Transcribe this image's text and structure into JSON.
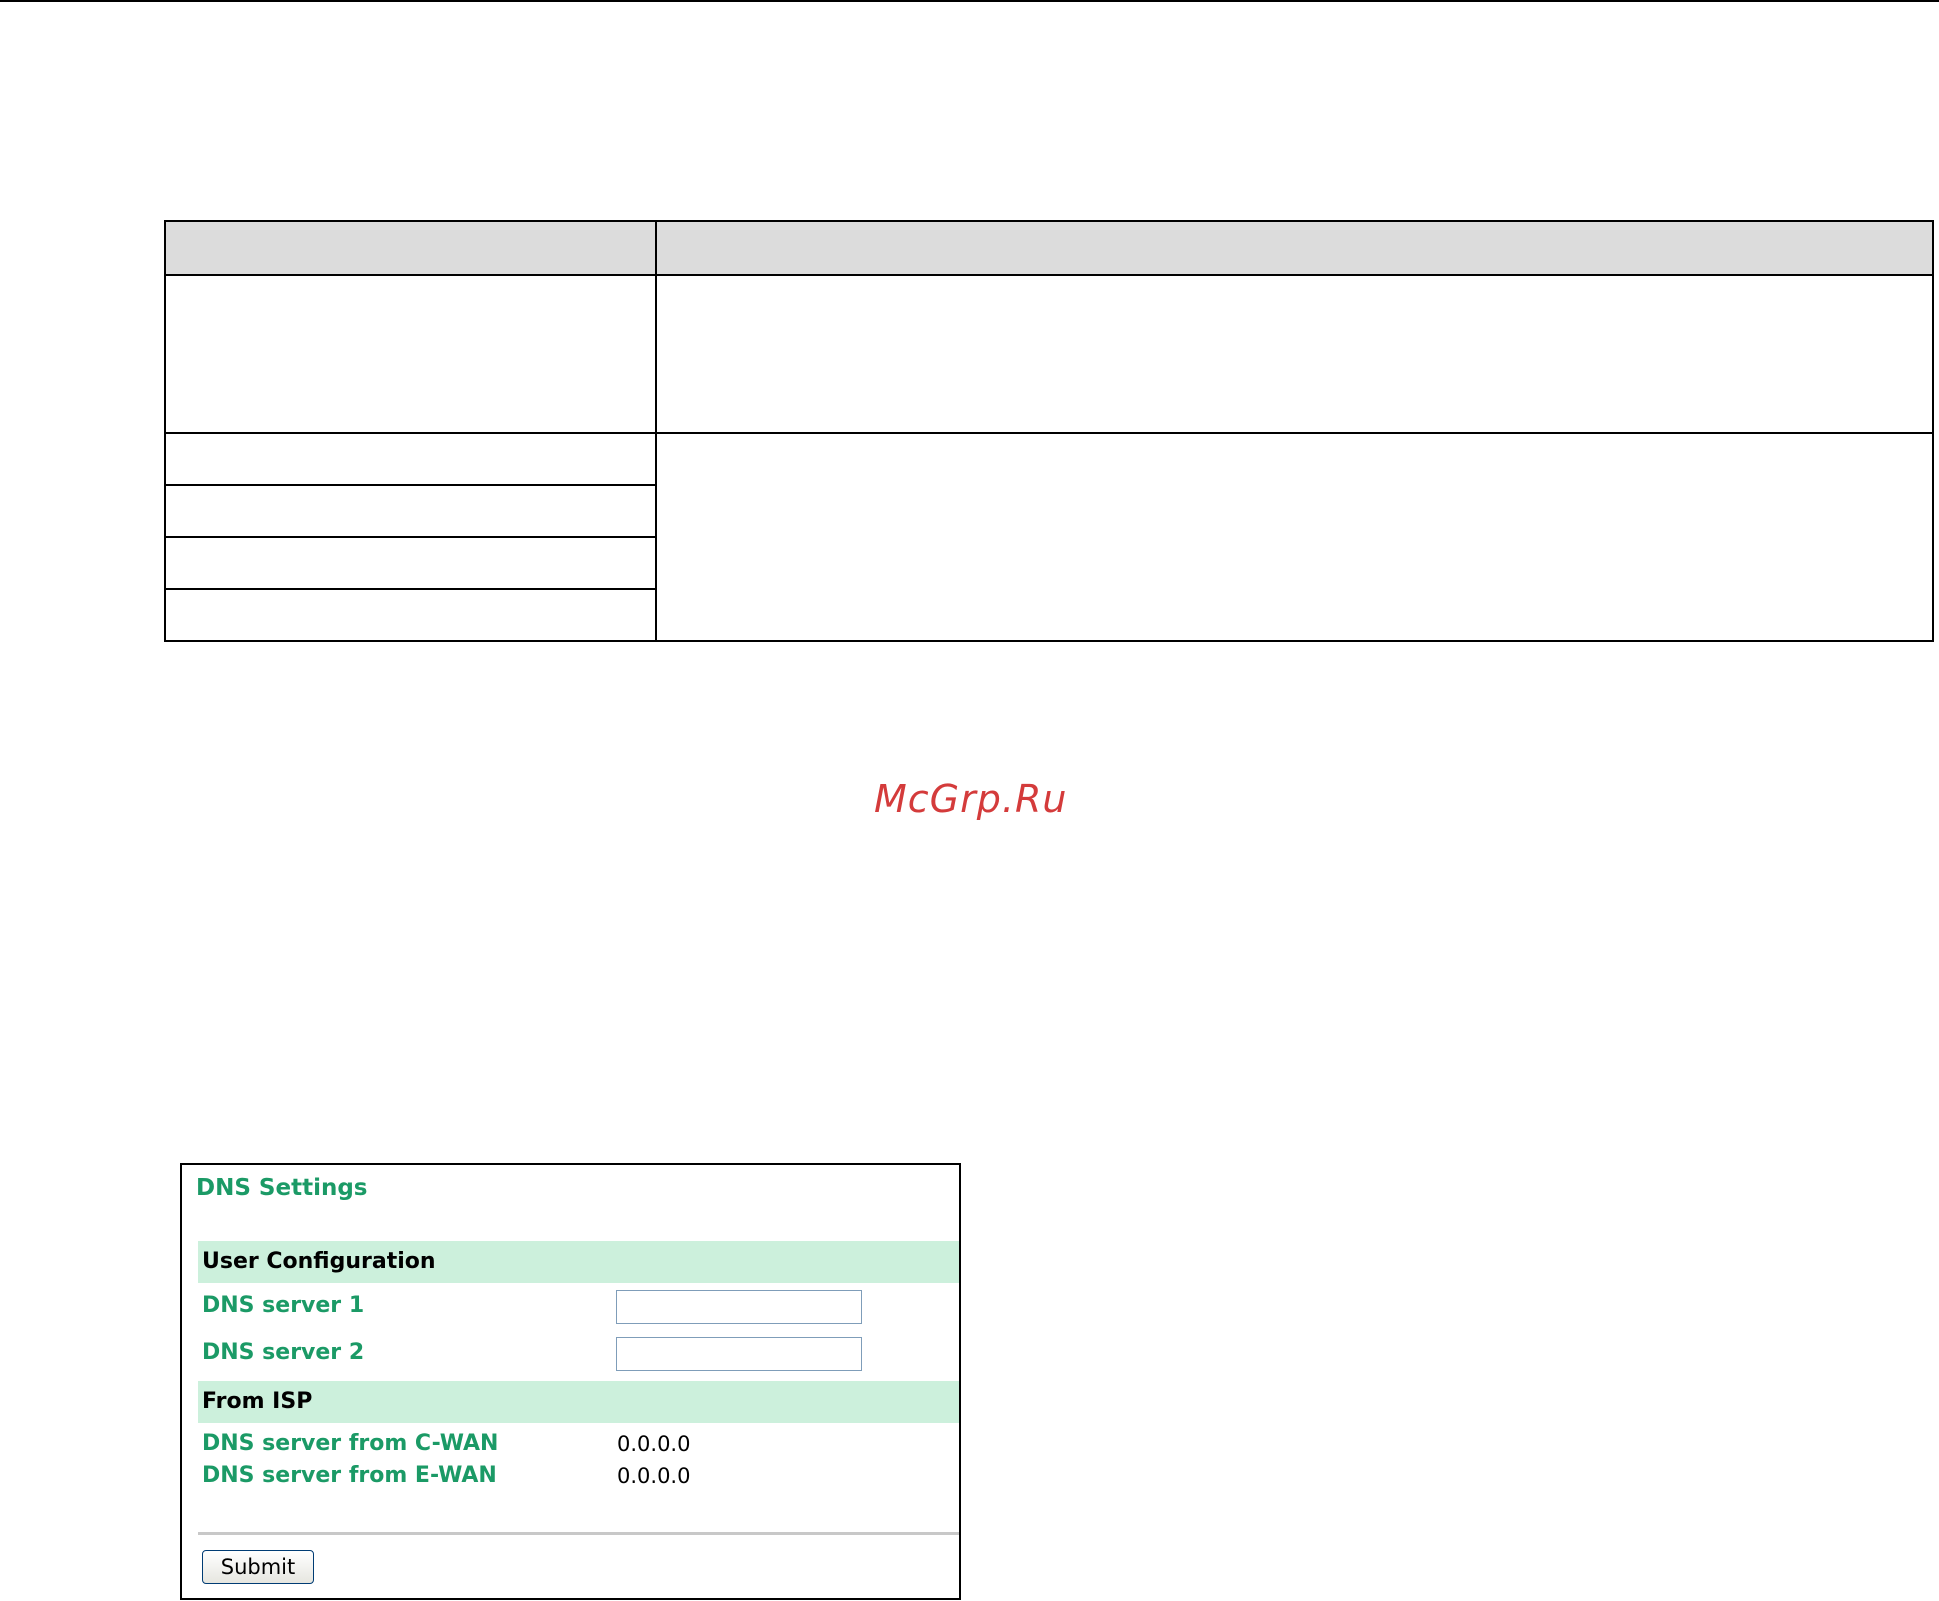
{
  "watermark": {
    "text": "McGrp.Ru"
  },
  "parameter_table": {
    "header": [
      "",
      ""
    ],
    "rows": [
      {
        "parameter": "",
        "description": ""
      },
      {
        "parameter": "",
        "description": ""
      },
      {
        "parameter": ""
      },
      {
        "parameter": ""
      },
      {
        "parameter": ""
      }
    ]
  },
  "dns_settings": {
    "title": "DNS Settings",
    "user_configuration": {
      "heading": "User Configuration",
      "dns_server_1": {
        "label": "DNS server 1",
        "value": ""
      },
      "dns_server_2": {
        "label": "DNS server 2",
        "value": ""
      }
    },
    "from_isp": {
      "heading": "From ISP",
      "c_wan": {
        "label": "DNS server from C-WAN",
        "value": "0.0.0.0"
      },
      "e_wan": {
        "label": "DNS server from E-WAN",
        "value": "0.0.0.0"
      }
    },
    "submit_label": "Submit"
  },
  "colors": {
    "label_green": "#1b9a66",
    "section_bar": "#ccf0dc",
    "table_header": "#dcdcdc",
    "watermark_red": "#d43b3b"
  }
}
